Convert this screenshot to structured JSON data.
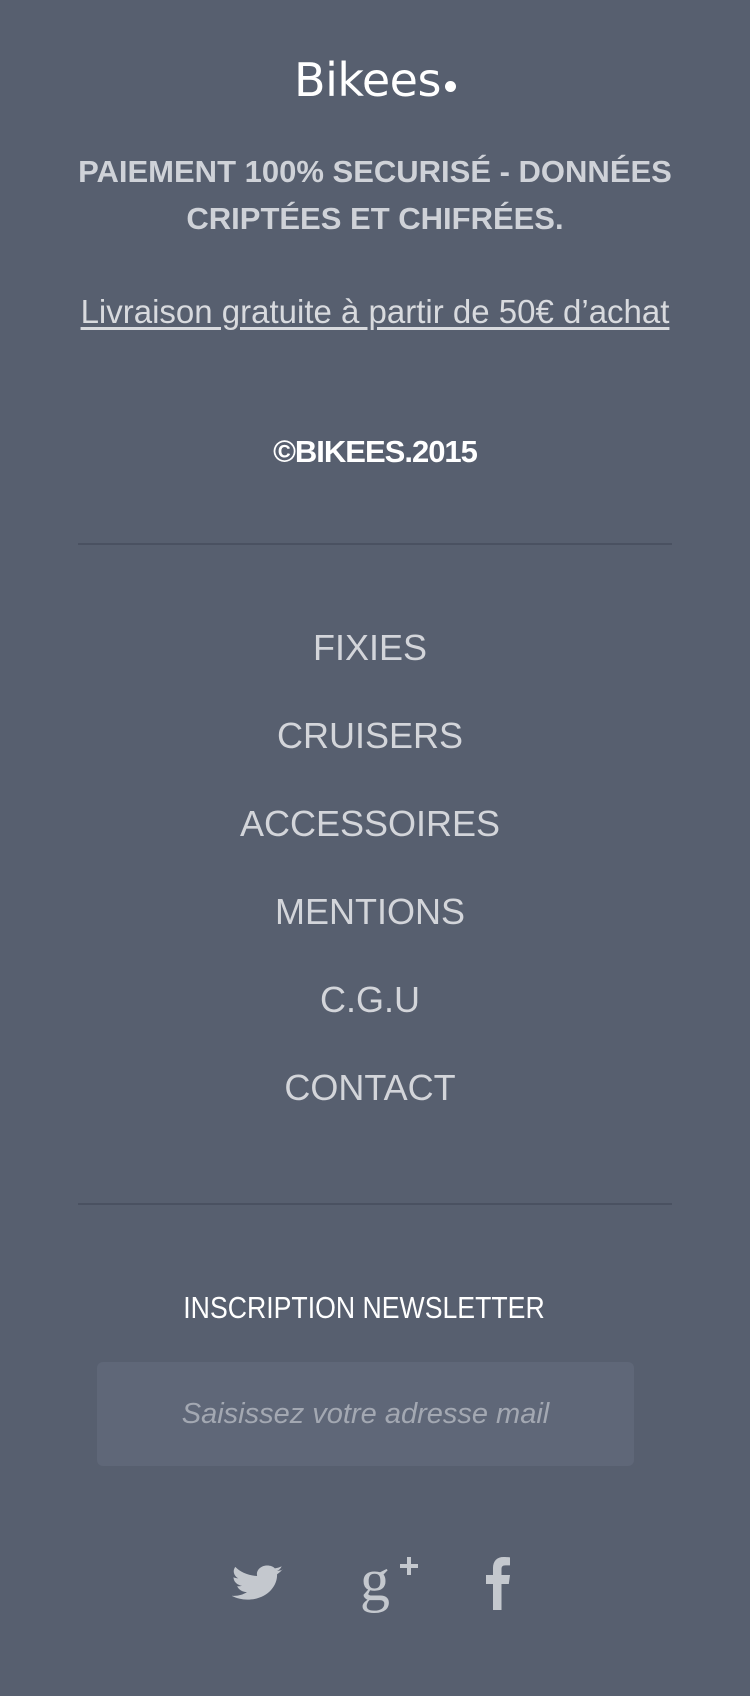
{
  "brand": {
    "name": "Bikees"
  },
  "footer": {
    "secure_text": "PAIEMENT 100% SECURISÉ - DONNÉES CRIPTÉES ET CHIFRÉES.",
    "delivery_link": "Livraison gratuite à partir de 50€ d’achat",
    "copyright": "©BIKEES.2015"
  },
  "nav": {
    "items": [
      {
        "label": "FIXIES"
      },
      {
        "label": "CRUISERS"
      },
      {
        "label": "ACCESSOIRES"
      },
      {
        "label": "MENTIONS"
      },
      {
        "label": "C.G.U"
      },
      {
        "label": "CONTACT"
      }
    ]
  },
  "newsletter": {
    "title": "INSCRIPTION NEWSLETTER",
    "placeholder": "Saisissez votre adresse mail",
    "value": ""
  },
  "social": {
    "icons": [
      "twitter-icon",
      "google-plus-icon",
      "facebook-icon"
    ]
  },
  "colors": {
    "background": "#575f6f",
    "divider": "#4a5161",
    "input_background": "#5f6778",
    "text_light": "#d3d5da",
    "icon": "#c4c8ce"
  }
}
